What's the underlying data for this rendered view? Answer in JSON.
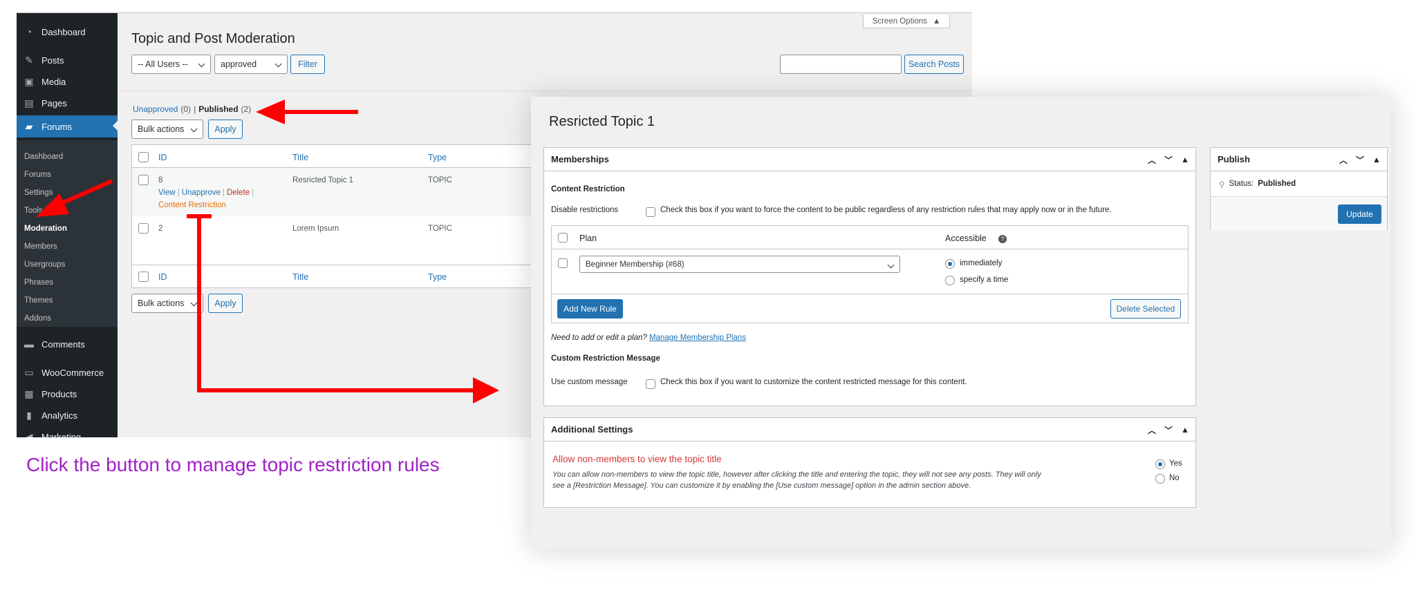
{
  "sidebar": {
    "items": [
      {
        "label": "Dashboard",
        "icon": "dashboard-icon"
      },
      {
        "label": "Posts",
        "icon": "pin-icon"
      },
      {
        "label": "Media",
        "icon": "media-icon"
      },
      {
        "label": "Pages",
        "icon": "pages-icon"
      },
      {
        "label": "Forums",
        "icon": "forums-icon"
      },
      {
        "label": "Comments",
        "icon": "comment-icon"
      },
      {
        "label": "WooCommerce",
        "icon": "woo-icon"
      },
      {
        "label": "Products",
        "icon": "archive-icon"
      },
      {
        "label": "Analytics",
        "icon": "chart-icon"
      },
      {
        "label": "Marketing",
        "icon": "megaphone-icon"
      }
    ],
    "submenu": [
      "Dashboard",
      "Forums",
      "Settings",
      "Tools",
      "Moderation",
      "Members",
      "Usergroups",
      "Phrases",
      "Themes",
      "Addons"
    ]
  },
  "moderation": {
    "screen_options": "Screen Options",
    "title": "Topic and Post Moderation",
    "user_filter": "-- All Users --",
    "status_filter": "approved",
    "filter_button": "Filter",
    "search_button": "Search Posts",
    "unapproved_label": "Unapproved",
    "unapproved_count": "(0)",
    "separator": "|",
    "published_label": "Published",
    "published_count": "(2)",
    "bulk_actions": "Bulk actions",
    "apply": "Apply",
    "columns": [
      "ID",
      "Title",
      "Type"
    ],
    "rows": [
      {
        "id": "8",
        "title": "Resricted Topic 1",
        "type": "TOPIC"
      },
      {
        "id": "2",
        "title": "Lorem Ipsum",
        "type": "TOPIC"
      }
    ],
    "row_actions": {
      "view": "View",
      "unapprove": "Unapprove",
      "delete": "Delete",
      "content_restriction": "Content Restriction",
      "sep": "|"
    }
  },
  "edit": {
    "title": "Resricted Topic 1",
    "memberships": {
      "heading": "Memberships",
      "content_restriction": "Content Restriction",
      "disable_label": "Disable restrictions",
      "disable_desc": "Check this box if you want to force the content to be public regardless of any restriction rules that may apply now or in the future.",
      "col_plan": "Plan",
      "col_accessible": "Accessible",
      "plan_value": "Beginner Membership (#68)",
      "opt_immediately": "immediately",
      "opt_specify": "specify a time",
      "add_rule": "Add New Rule",
      "delete_selected": "Delete Selected",
      "need_plan": "Need to add or edit a plan?",
      "manage_plans": "Manage Membership Plans",
      "custom_msg_heading": "Custom Restriction Message",
      "use_custom_label": "Use custom message",
      "use_custom_desc": "Check this box if you want to customize the content restricted message for this content."
    },
    "additional": {
      "heading": "Additional Settings",
      "allow_label": "Allow non-members to view the topic title",
      "desc1": "You can allow non-members to view the topic title, however after clicking the title and entering the topic, they will not see any posts. They will only",
      "desc2": "see a [Restriction Message]. You can customize it by enabling the [Use custom message] option in the admin section above.",
      "yes": "Yes",
      "no": "No"
    },
    "publish": {
      "heading": "Publish",
      "status_label": "Status:",
      "status_value": "Published",
      "update": "Update"
    }
  },
  "caption": "Click the button to manage topic restriction rules",
  "colors": {
    "accent": "#2271b1",
    "annotation": "#ff0000",
    "caption": "#a020c8",
    "delete": "#b32d2e",
    "restriction": "#e46f00"
  }
}
